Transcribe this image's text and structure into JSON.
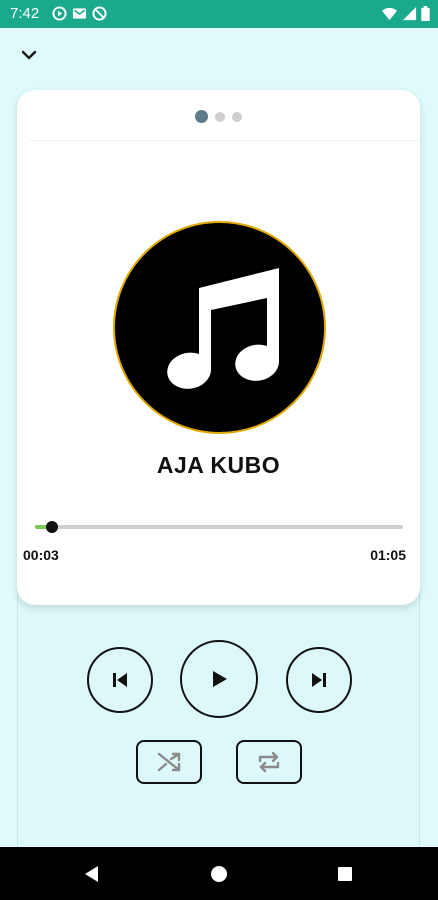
{
  "status_bar": {
    "time": "7:42",
    "background": "#1aa98c",
    "left_icons": [
      "play-circle-icon",
      "mail-icon",
      "media-blocked-icon"
    ],
    "right_icons": [
      "wifi-icon",
      "signal-icon",
      "battery-icon"
    ]
  },
  "header": {
    "collapse_icon": "chevron-down-icon"
  },
  "pager": {
    "pages": 3,
    "active_index": 0
  },
  "player": {
    "album_art_icon": "music-note-icon",
    "album_art_border": "#e0a800",
    "song_title": "AJA KUBO",
    "progress_fraction": 0.045,
    "progress_color": "#7ccc5a",
    "time_current": "00:03",
    "time_total": "01:05"
  },
  "controls": {
    "previous_icon": "skip-previous-icon",
    "play_icon": "play-icon",
    "next_icon": "skip-next-icon",
    "shuffle_icon": "shuffle-icon",
    "repeat_icon": "repeat-icon"
  },
  "nav_bar": {
    "back_icon": "back-triangle-icon",
    "home_icon": "home-circle-icon",
    "recents_icon": "recents-square-icon"
  }
}
